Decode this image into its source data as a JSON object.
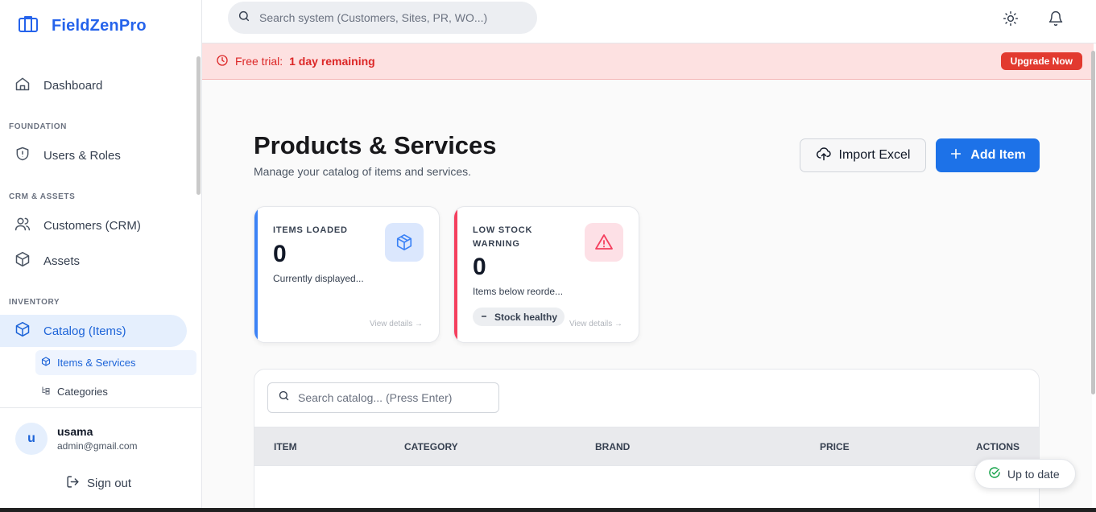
{
  "app": {
    "name": "FieldZenPro"
  },
  "sidebar": {
    "dashboard": "Dashboard",
    "sections": [
      {
        "label": "FOUNDATION"
      },
      {
        "label": "CRM & ASSETS"
      },
      {
        "label": "INVENTORY"
      }
    ],
    "items": {
      "users_roles": "Users & Roles",
      "customers": "Customers (CRM)",
      "assets": "Assets",
      "catalog": "Catalog (Items)"
    },
    "sub_items": {
      "items_services": "Items & Services",
      "categories": "Categories"
    },
    "user": {
      "initial": "u",
      "name": "usama",
      "email": "admin@gmail.com"
    },
    "signout": "Sign out"
  },
  "topbar": {
    "search_placeholder": "Search system (Customers, Sites, PR, WO...)"
  },
  "banner": {
    "prefix": "Free trial:",
    "remaining": "1 day remaining",
    "upgrade": "Upgrade Now"
  },
  "page": {
    "title": "Products & Services",
    "subtitle": "Manage your catalog of items and services.",
    "import_button": "Import Excel",
    "add_button": "Add Item"
  },
  "stats": [
    {
      "label": "ITEMS LOADED",
      "value": "0",
      "desc": "Currently displayed...",
      "link": "View details →",
      "accent": "#3b82f6",
      "icon": "package-icon"
    },
    {
      "label_line1": "LOW STOCK",
      "label_line2": "WARNING",
      "value": "0",
      "desc": "Items below reorde...",
      "badge": "Stock healthy",
      "link": "View details →",
      "accent": "#f43f5e",
      "icon": "alert-triangle-icon"
    }
  ],
  "table": {
    "search_placeholder": "Search catalog... (Press Enter)",
    "columns": [
      "ITEM",
      "CATEGORY",
      "BRAND",
      "PRICE",
      "ACTIONS"
    ]
  },
  "toast": {
    "label": "Up to date"
  },
  "colors": {
    "brand": "#2563eb",
    "primary_button": "#1d72e8",
    "danger": "#e23a2f",
    "banner_bg": "#fde1e1"
  }
}
